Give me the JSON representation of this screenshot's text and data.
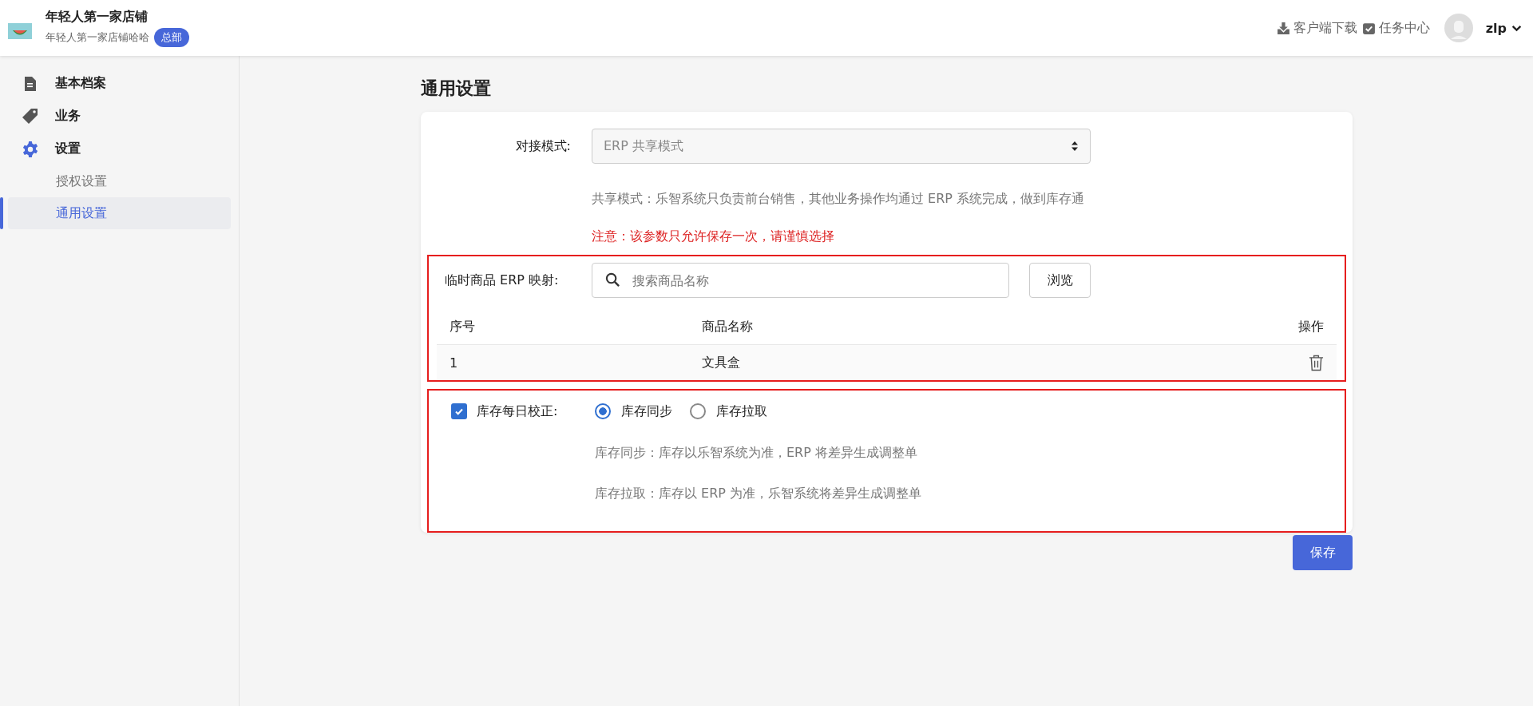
{
  "header": {
    "store_name": "年轻人第一家店铺",
    "store_subtitle": "年轻人第一家店铺哈哈",
    "badge": "总部",
    "links": [
      {
        "label": "客户端下载"
      },
      {
        "label": "任务中心"
      }
    ],
    "user": "zlp"
  },
  "sidebar": {
    "items": [
      {
        "label": "基本档案",
        "expanded": false
      },
      {
        "label": "业务",
        "expanded": false
      },
      {
        "label": "设置",
        "expanded": true,
        "children": [
          {
            "label": "授权设置",
            "selected": false
          },
          {
            "label": "通用设置",
            "selected": true
          }
        ]
      }
    ]
  },
  "page_title": "通用设置",
  "mode": {
    "label": "对接模式:",
    "value": "ERP 共享模式",
    "help": "共享模式：乐智系统只负责前台销售，其他业务操作均通过 ERP 系统完成，做到库存通",
    "warning": "注意：该参数只允许保存一次，请谨慎选择"
  },
  "mapping": {
    "label": "临时商品 ERP 映射:",
    "search": {
      "placeholder": "搜索商品名称"
    },
    "browse_button": "浏览",
    "table": {
      "columns": [
        "序号",
        "商品名称",
        "操作"
      ],
      "rows": [
        {
          "index": "1",
          "name": "文具盒"
        }
      ]
    }
  },
  "stock_check": {
    "label": "库存每日校正:",
    "checked": true,
    "options": [
      {
        "label": "库存同步",
        "selected": true
      },
      {
        "label": "库存拉取",
        "selected": false
      }
    ],
    "notes": [
      "库存同步：库存以乐智系统为准，ERP 将差异生成调整单",
      "库存拉取：库存以 ERP 为准，乐智系统将差异生成调整单"
    ]
  },
  "save_button": "保存"
}
